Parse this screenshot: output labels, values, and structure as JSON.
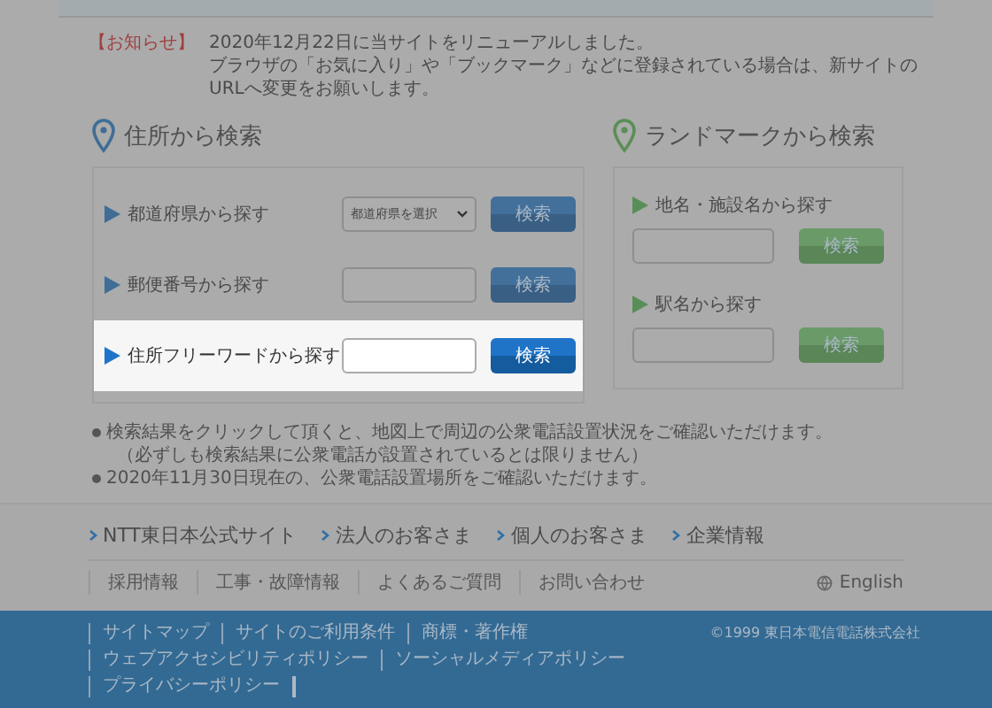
{
  "notice": {
    "tag": "【お知らせ】",
    "lines": [
      "2020年12月22日に当サイトをリニューアルしました。",
      "ブラウザの「お気に入り」や「ブックマーク」などに登録されている場合は、新サイトのURLへ変更をお願いします。"
    ]
  },
  "address_search": {
    "title": "住所から検索",
    "rows": [
      {
        "kind": "select",
        "label": "都道府県から探す",
        "value": "都道府県を選択",
        "button": "検索",
        "highlighted": false
      },
      {
        "kind": "input",
        "label": "郵便番号から探す",
        "button": "検索",
        "highlighted": false
      },
      {
        "kind": "input",
        "label": "住所フリーワードから探す",
        "button": "検索",
        "highlighted": true
      }
    ]
  },
  "landmark_search": {
    "title": "ランドマークから検索",
    "rows": [
      {
        "label": "地名・施設名から探す",
        "button": "検索"
      },
      {
        "label": "駅名から探す",
        "button": "検索"
      }
    ]
  },
  "notes": [
    {
      "lines": [
        "検索結果をクリックして頂くと、地図上で周辺の公衆電話設置状況をご確認いただけます。",
        "（必ずしも検索結果に公衆電話が設置されているとは限りません）"
      ]
    },
    {
      "lines": [
        "2020年11月30日現在の、公衆電話設置場所をご確認いただけます。"
      ]
    }
  ],
  "footer": {
    "main_links": [
      "NTT東日本公式サイト",
      "法人のお客さま",
      "個人のお客さま",
      "企業情報"
    ],
    "sub_links": [
      "採用情報",
      "工事・故障情報",
      "よくあるご質問",
      "お問い合わせ"
    ],
    "language": "English",
    "bottom_links": [
      "サイトマップ",
      "サイトのご利用条件",
      "商標・著作権",
      "ウェブアクセシビリティポリシー",
      "ソーシャルメディアポリシー",
      "プライバシーポリシー"
    ],
    "copyright": "©1999 東日本電信電話株式会社"
  }
}
